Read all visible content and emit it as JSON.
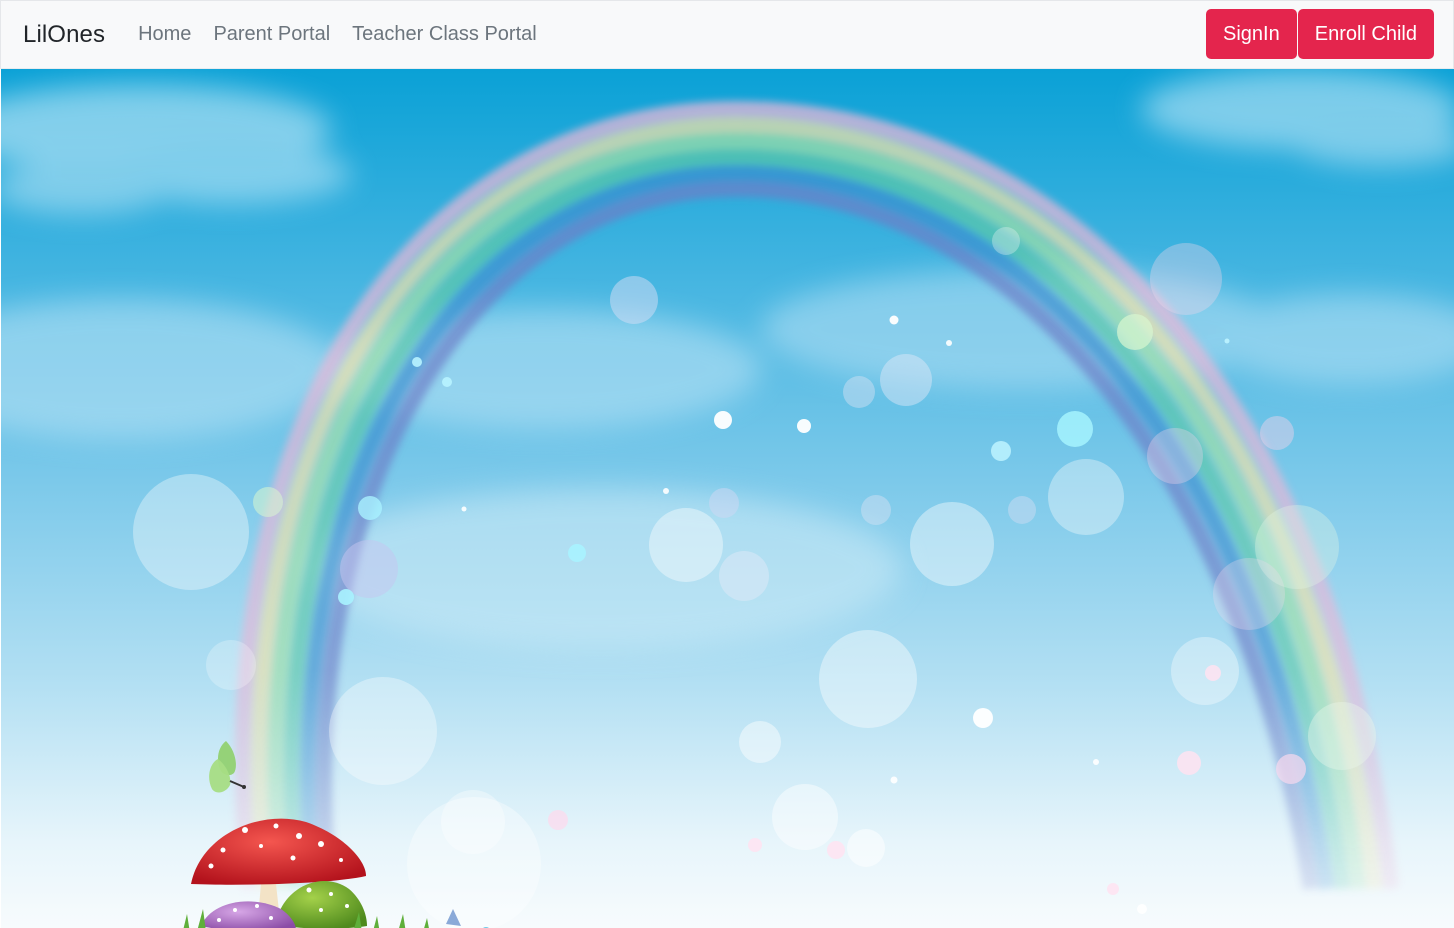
{
  "navbar": {
    "brand": "LilOnes",
    "links": [
      {
        "label": "Home"
      },
      {
        "label": "Parent Portal"
      },
      {
        "label": "Teacher Class Portal"
      }
    ],
    "signin_label": "SignIn",
    "enroll_label": "Enroll Child"
  },
  "colors": {
    "navbar_bg": "#f8f9fa",
    "accent_button": "#e4254d",
    "sky_top": "#0aa1d6",
    "sky_bottom": "#f7fbfd"
  },
  "icons": [
    "butterfly-icon",
    "mushroom-cluster-icon"
  ]
}
